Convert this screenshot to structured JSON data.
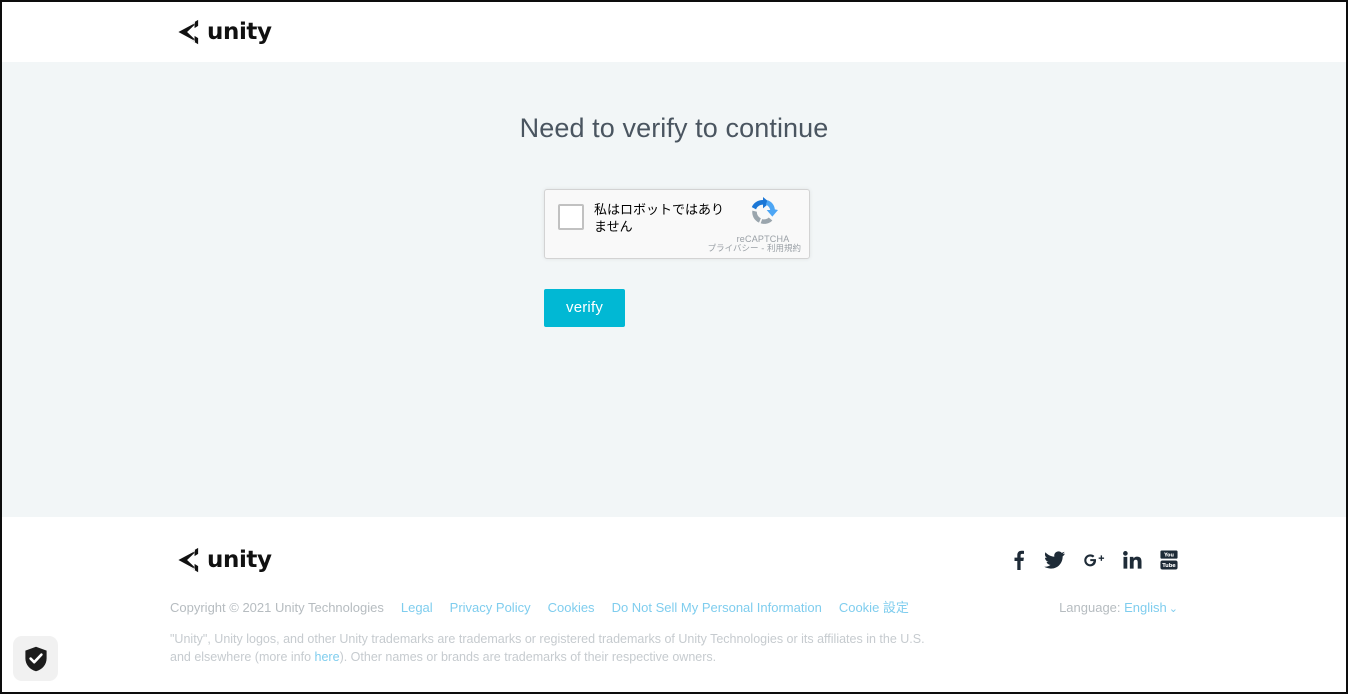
{
  "header": {
    "logo_alt": "unity",
    "wordmark": "unity"
  },
  "main": {
    "title": "Need to verify to continue",
    "recaptcha": {
      "checkbox_label": "私はロボットではありません",
      "brand_name": "reCAPTCHA",
      "privacy_label": "プライバシー",
      "terms_separator": " - ",
      "terms_label": "利用規約"
    },
    "verify_button_label": "verify"
  },
  "footer": {
    "wordmark": "unity",
    "social": [
      {
        "name": "facebook",
        "label": "Facebook"
      },
      {
        "name": "twitter",
        "label": "Twitter"
      },
      {
        "name": "googleplus",
        "label": "Google Plus"
      },
      {
        "name": "linkedin",
        "label": "LinkedIn"
      },
      {
        "name": "youtube",
        "label": "YouTube"
      }
    ],
    "copyright": "Copyright © 2021 Unity Technologies",
    "links": [
      {
        "label": "Legal"
      },
      {
        "label": "Privacy Policy"
      },
      {
        "label": "Cookies"
      },
      {
        "label": "Do Not Sell My Personal Information"
      },
      {
        "label": "Cookie 設定"
      }
    ],
    "language_label": "Language:",
    "language_value": "English",
    "language_caret": "⌄",
    "trademark_part1": "\"Unity\", Unity logos, and other Unity trademarks are trademarks or registered trademarks of Unity Technologies or its affiliates in the U.S. and elsewhere (more info ",
    "trademark_link": "here",
    "trademark_part2": "). Other names or brands are trademarks of their respective owners."
  },
  "privacy_badge": {
    "icon": "shield-check-icon"
  },
  "colors": {
    "accent_cyan": "#01b8d4",
    "link_blue": "#7fcdee",
    "main_bg": "#f2f6f7",
    "title_text": "#4a5560",
    "muted_text": "#b6bcc0"
  }
}
